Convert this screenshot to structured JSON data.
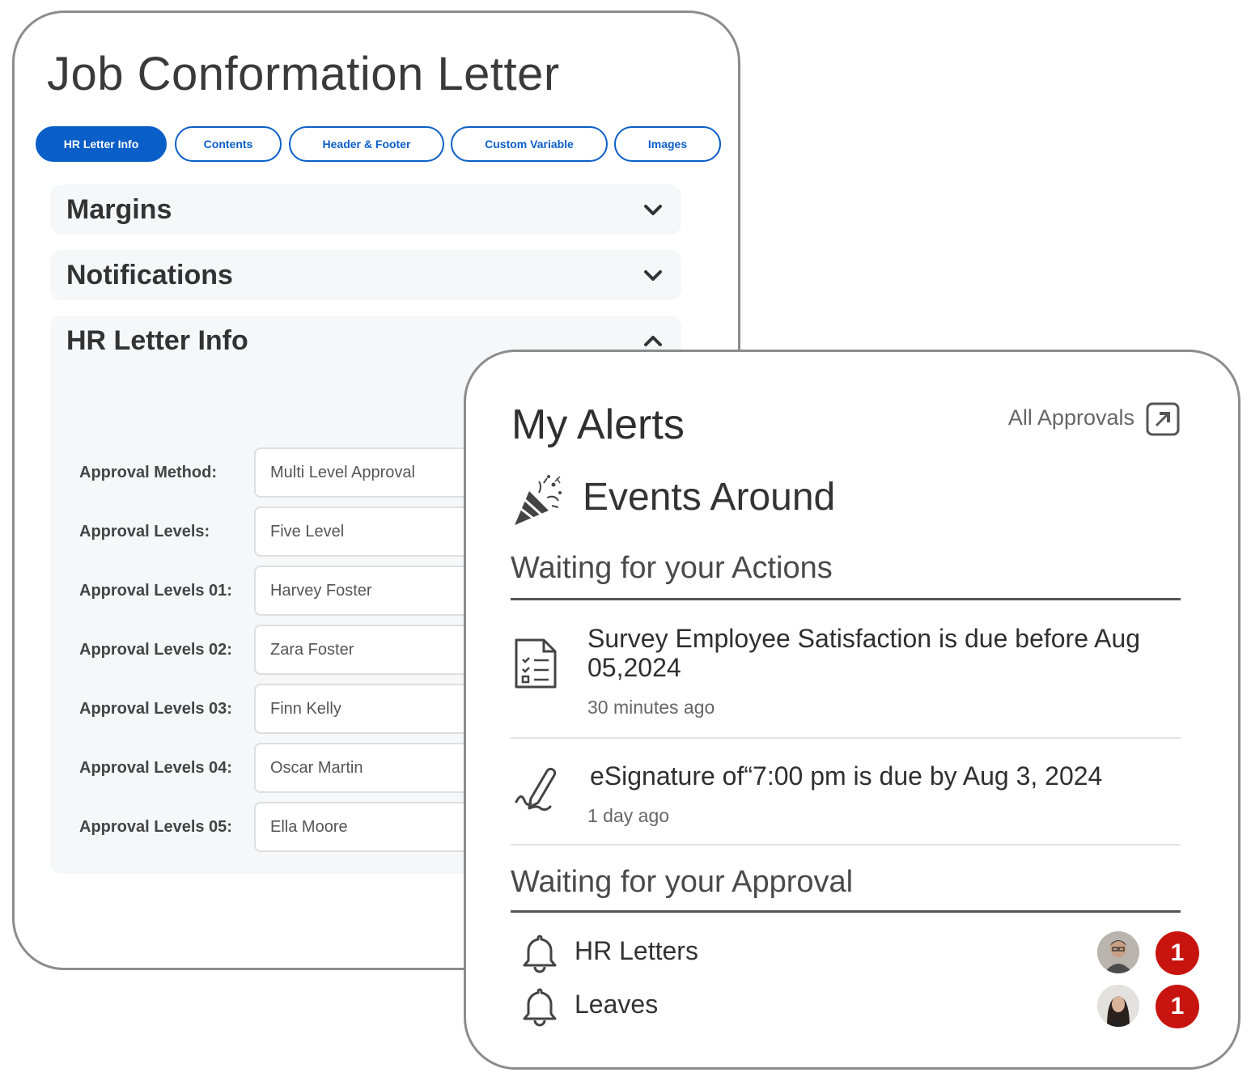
{
  "letter": {
    "title": "Job Conformation Letter",
    "tabs": [
      {
        "label": "HR Letter Info",
        "active": true
      },
      {
        "label": "Contents",
        "active": false
      },
      {
        "label": "Header & Footer",
        "active": false
      },
      {
        "label": "Custom Variable",
        "active": false
      },
      {
        "label": "Images",
        "active": false
      }
    ],
    "sections": {
      "margins": {
        "title": "Margins",
        "expanded": false
      },
      "notifications": {
        "title": "Notifications",
        "expanded": false
      },
      "hr_letter_info": {
        "title": "HR Letter Info",
        "expanded": true
      }
    },
    "fields": [
      {
        "label": "Approval Method:",
        "value": "Multi Level Approval"
      },
      {
        "label": "Approval Levels:",
        "value": "Five Level"
      },
      {
        "label": "Approval Levels 01:",
        "value": "Harvey Foster"
      },
      {
        "label": "Approval Levels 02:",
        "value": "Zara Foster"
      },
      {
        "label": "Approval Levels 03:",
        "value": "Finn Kelly"
      },
      {
        "label": "Approval Levels 04:",
        "value": "Oscar Martin"
      },
      {
        "label": "Approval Levels 05:",
        "value": "Ella Moore"
      }
    ]
  },
  "alerts": {
    "title": "My Alerts",
    "all_approvals_link": "All Approvals",
    "events_title": "Events Around",
    "actions_heading": "Waiting for your Actions",
    "actions": [
      {
        "icon": "checklist-document-icon",
        "text": "Survey Employee Satisfaction is due before Aug 05,2024",
        "time": "30 minutes ago"
      },
      {
        "icon": "signature-pen-icon",
        "text": "eSignature of“7:00 pm is due by Aug 3, 2024",
        "time": "1 day ago"
      }
    ],
    "approval_heading": "Waiting for your Approval",
    "approvals": [
      {
        "icon": "bell-icon",
        "label": "HR Letters",
        "count": "1"
      },
      {
        "icon": "bell-icon",
        "label": "Leaves",
        "count": "1"
      }
    ]
  },
  "colors": {
    "primary_blue": "#0a5ec8",
    "badge_red": "#c8140f",
    "card_border": "#8c8c8c",
    "panel_bg": "#f6f7f8"
  }
}
